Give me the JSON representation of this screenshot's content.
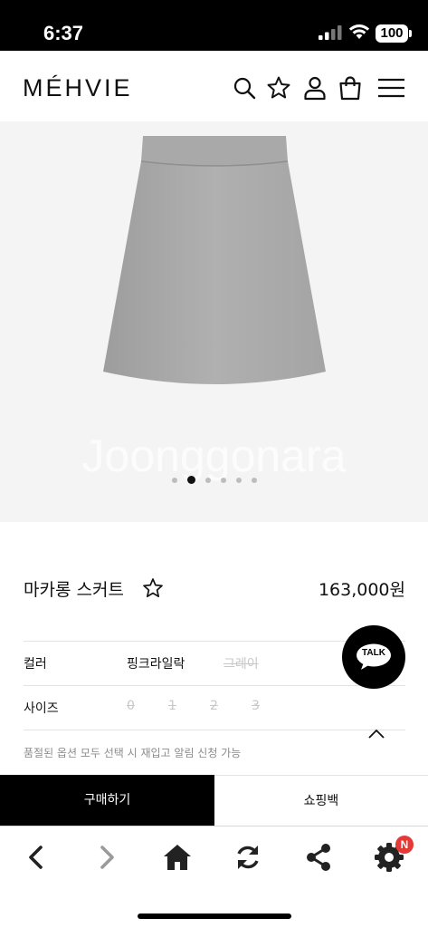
{
  "status_bar": {
    "time": "6:37",
    "battery": "100"
  },
  "header": {
    "logo": "MÉHVIE",
    "icons": [
      "search-icon",
      "star-icon",
      "user-icon",
      "shopping-bag-icon",
      "menu-icon"
    ]
  },
  "gallery": {
    "watermark": "Joonggonara",
    "dot_count": 6,
    "active_index": 1
  },
  "product": {
    "name": "마카롱 스커트",
    "price": "163,000원"
  },
  "options": {
    "color": {
      "label": "컬러",
      "values": [
        {
          "text": "핑크라일락",
          "available": true
        },
        {
          "text": "그레이",
          "available": false
        }
      ]
    },
    "size": {
      "label": "사이즈",
      "values": [
        {
          "text": "0",
          "available": false
        },
        {
          "text": "1",
          "available": false
        },
        {
          "text": "2",
          "available": false
        },
        {
          "text": "3",
          "available": false
        }
      ]
    }
  },
  "notice": "품절된 옵션 모두 선택 시 재입고 알림 신청 가능",
  "talk_button": {
    "label": "TALK"
  },
  "actions": {
    "buy": "구매하기",
    "cart": "쇼핑백"
  },
  "browser_toolbar": {
    "icons": [
      "back-icon",
      "forward-icon",
      "home-icon",
      "refresh-icon",
      "share-icon",
      "settings-icon"
    ],
    "badge": "N"
  },
  "colors": {
    "accent": "#000000",
    "badge": "#e53935",
    "disabled": "#c8c8c8"
  }
}
